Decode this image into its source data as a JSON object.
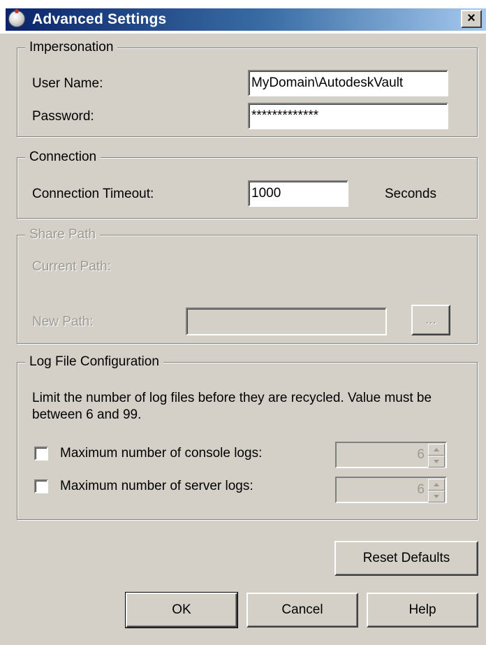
{
  "window": {
    "title": "Advanced Settings",
    "close_glyph": "×"
  },
  "impersonation": {
    "legend": "Impersonation",
    "user_name_label": "User Name:",
    "user_name_value": "MyDomain\\AutodeskVault",
    "password_label": "Password:",
    "password_value": "*************"
  },
  "connection": {
    "legend": "Connection",
    "timeout_label": "Connection Timeout:",
    "timeout_value": "1000",
    "timeout_unit": "Seconds"
  },
  "share_path": {
    "legend": "Share Path",
    "current_path_label": "Current Path:",
    "new_path_label": "New Path:",
    "new_path_value": "",
    "browse_label": "..."
  },
  "log_config": {
    "legend": "Log File Configuration",
    "description": "Limit the number of log files before they are recycled. Value must be between 6 and 99.",
    "console_label": "Maximum number of console logs:",
    "console_checked": false,
    "console_value": "6",
    "server_label": "Maximum number of server logs:",
    "server_checked": false,
    "server_value": "6"
  },
  "buttons": {
    "reset_defaults": "Reset Defaults",
    "ok": "OK",
    "cancel": "Cancel",
    "help": "Help"
  },
  "colors": {
    "title_gradient_start": "#0a246a",
    "title_gradient_end": "#a6caf0",
    "dialog_face": "#d4d0c8",
    "disabled_text": "#9c9a94"
  }
}
